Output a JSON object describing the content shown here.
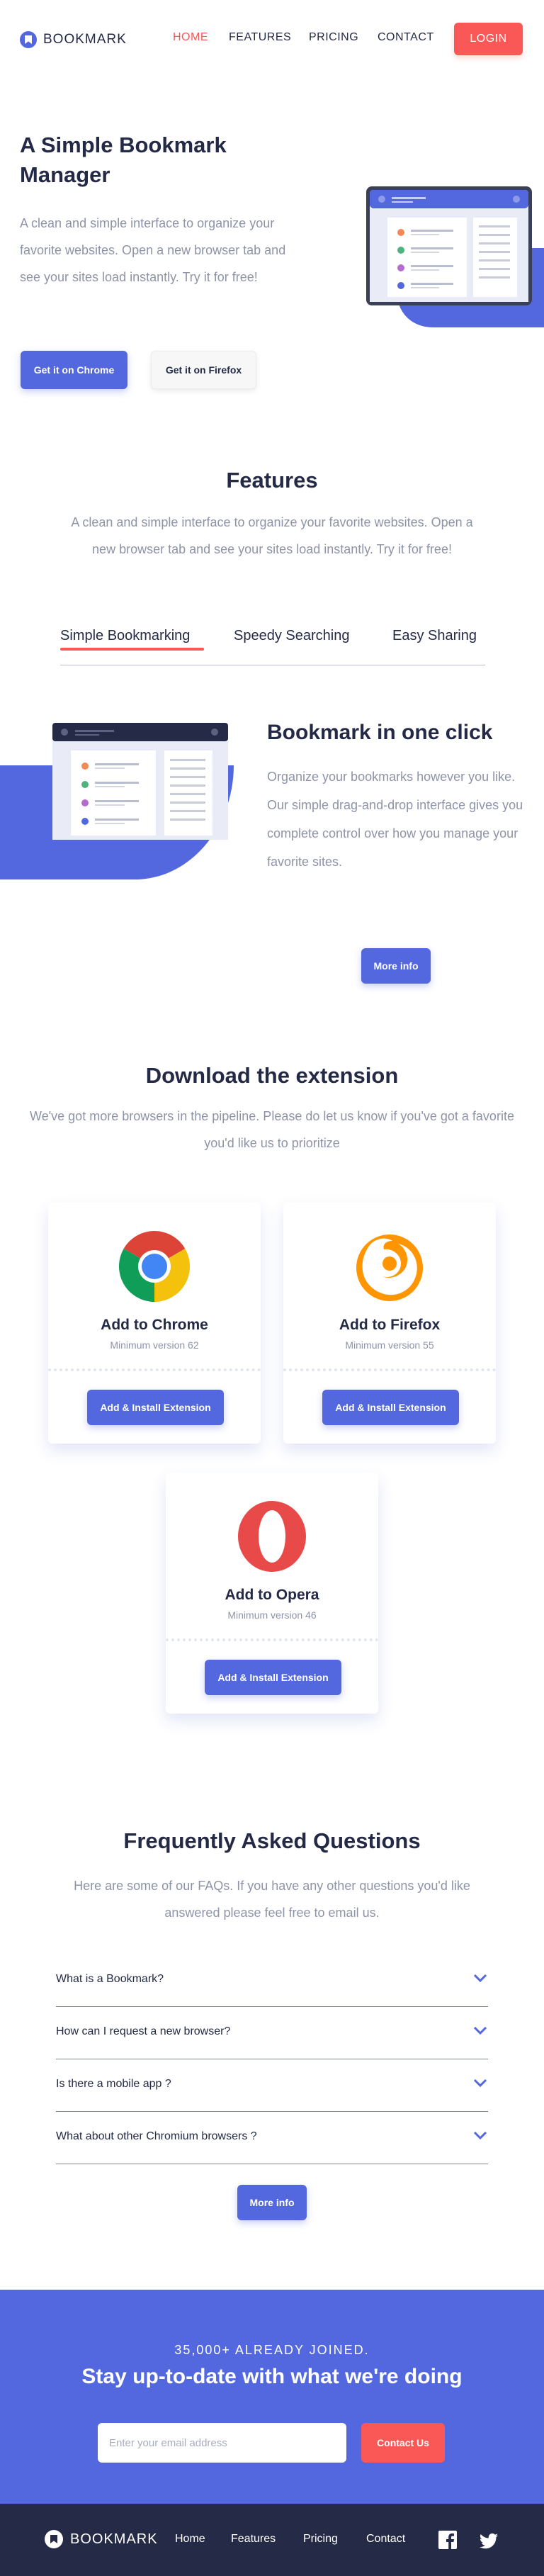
{
  "header": {
    "logo_text": "BOOKMARK",
    "nav": [
      "HOME",
      "FEATURES",
      "PRICING",
      "CONTACT"
    ],
    "login": "LOGIN"
  },
  "hero": {
    "title": "A Simple Bookmark Manager",
    "text": "A clean and simple interface to organize your favorite websites. Open a new browser tab and see your sites load instantly. Try it for free!",
    "chrome_button": "Get it on Chrome",
    "firefox_button": "Get it on Firefox"
  },
  "features": {
    "title": "Features",
    "text": "A clean and simple interface to organize your favorite websites. Open a new browser tab and see your sites load instantly. Try it for free!",
    "tabs": [
      "Simple Bookmarking",
      "Speedy Searching",
      "Easy Sharing"
    ],
    "active_tab": "Simple Bookmarking",
    "panel_title": "Bookmark in one click",
    "panel_text": "Organize your bookmarks however you like. Our simple drag-and-drop interface gives you complete control over how you manage your favorite sites.",
    "more_info": "More info"
  },
  "download": {
    "title": "Download the extension",
    "text": "We've got more browsers in the pipeline. Please do let us know if you've got a favorite you'd like us to prioritize",
    "cards": [
      {
        "title": "Add to Chrome",
        "sub": "Minimum version 62",
        "button": "Add & Install Extension"
      },
      {
        "title": "Add to Firefox",
        "sub": "Minimum version 55",
        "button": "Add & Install Extension"
      },
      {
        "title": "Add to Opera",
        "sub": "Minimum version 46",
        "button": "Add & Install Extension"
      }
    ]
  },
  "faq": {
    "title": "Frequently Asked Questions",
    "text": "Here are some of our FAQs. If you have any other questions you'd like answered please feel free to email us.",
    "questions": [
      "What is a Bookmark?",
      "How can I request a new browser?",
      "Is there a mobile app ?",
      "What about other Chromium browsers ?"
    ],
    "more_info": "More info"
  },
  "cta": {
    "small": "35,000+ ALREADY JOINED.",
    "big": "Stay up-to-date with what we're doing",
    "placeholder": "Enter your email address",
    "button": "Contact Us"
  },
  "footer": {
    "logo_text": "BOOKMARK",
    "links": [
      "Home",
      "Features",
      "Pricing",
      "Contact"
    ]
  },
  "colors": {
    "accent_blue": "#5368df",
    "accent_red": "#fa5757",
    "dark_navy": "#242a45",
    "text_grey": "#8e93a8"
  }
}
